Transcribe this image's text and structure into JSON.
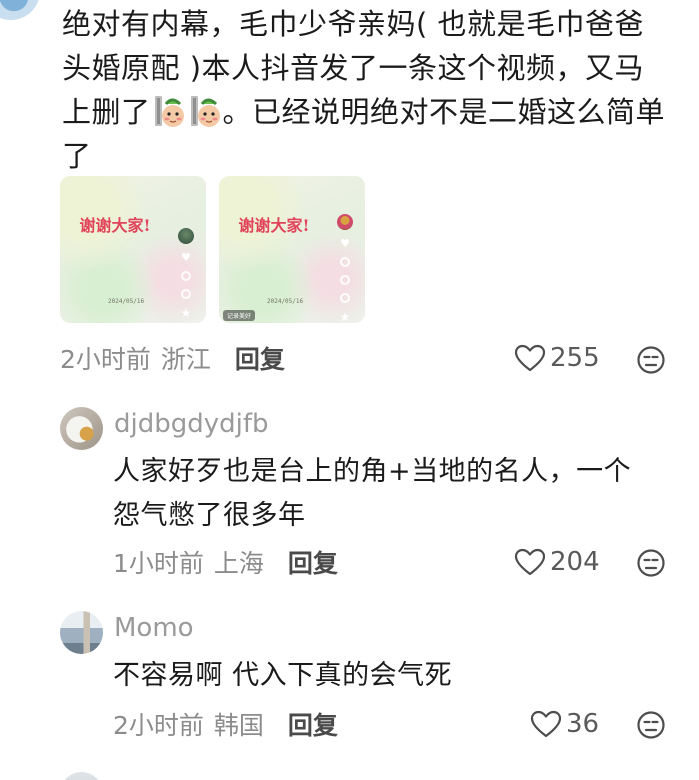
{
  "main_comment": {
    "text_line1": "绝对有内幕，毛巾少爷亲妈( 也就是毛巾爸爸",
    "text_line2": "头婚原配 )本人抖音发了一条这个视频，又马",
    "text_line3_before": "上删了",
    "text_line3_after": "。已经说明绝对不是二婚这么简单",
    "text_line4": "了",
    "emoji": [
      "peeking-emoji",
      "peeking-emoji"
    ],
    "videos": [
      {
        "title": "谢谢大家!",
        "date": "2024/05/16"
      },
      {
        "title": "谢谢大家!",
        "date": "2024/05/16",
        "badge": "记录美好"
      }
    ],
    "time": "2小时前",
    "location": "浙江",
    "reply_label": "回复",
    "likes": "255"
  },
  "replies": [
    {
      "username": "djdbgdydjfb",
      "text_line1": "人家好歹也是台上的角+当地的名人，一个",
      "text_line2": "怨气憋了很多年",
      "time": "1小时前",
      "location": "上海",
      "reply_label": "回复",
      "likes": "204"
    },
    {
      "username": "Momo",
      "text_line1": "不容易啊 代入下真的会气死",
      "time": "2小时前",
      "location": "韩国",
      "reply_label": "回复",
      "likes": "36"
    }
  ],
  "colors": {
    "text": "#1b1b1b",
    "meta": "#8c8c8c",
    "username": "#9a9a9a",
    "video_title": "#e0435a"
  }
}
